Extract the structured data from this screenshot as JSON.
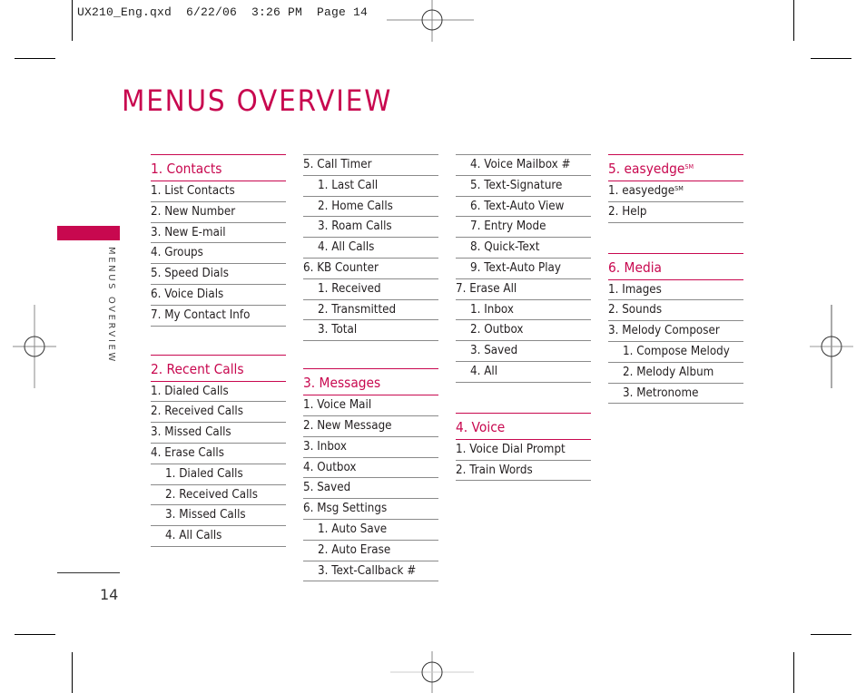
{
  "slug": {
    "text": "UX210_Eng.qxd  6/22/06  3:26 PM  Page 14"
  },
  "page": {
    "title": "MENUS OVERVIEW",
    "side_label": "MENUS OVERVIEW",
    "page_number": "14",
    "accent_color": "#c8084f"
  },
  "columns": [
    {
      "sections": [
        {
          "heading": "1. Contacts",
          "items": [
            {
              "label": "1. List Contacts",
              "level": 1
            },
            {
              "label": "2. New Number",
              "level": 1
            },
            {
              "label": "3. New E-mail",
              "level": 1
            },
            {
              "label": "4. Groups",
              "level": 1
            },
            {
              "label": "5. Speed Dials",
              "level": 1
            },
            {
              "label": "6. Voice Dials",
              "level": 1
            },
            {
              "label": "7.  My Contact Info",
              "level": 1
            }
          ]
        },
        {
          "heading": "2. Recent Calls",
          "items": [
            {
              "label": "1. Dialed Calls",
              "level": 1
            },
            {
              "label": "2. Received Calls",
              "level": 1
            },
            {
              "label": "3. Missed Calls",
              "level": 1
            },
            {
              "label": "4. Erase Calls",
              "level": 1
            },
            {
              "label": "1. Dialed Calls",
              "level": 2
            },
            {
              "label": "2. Received Calls",
              "level": 2
            },
            {
              "label": "3. Missed Calls",
              "level": 2
            },
            {
              "label": "4. All Calls",
              "level": 2
            }
          ]
        }
      ]
    },
    {
      "sections": [
        {
          "heading": null,
          "items": [
            {
              "label": "5. Call Timer",
              "level": 1
            },
            {
              "label": "1. Last Call",
              "level": 2
            },
            {
              "label": "2. Home Calls",
              "level": 2
            },
            {
              "label": "3. Roam Calls",
              "level": 2
            },
            {
              "label": "4. All Calls",
              "level": 2
            },
            {
              "label": "6. KB Counter",
              "level": 1
            },
            {
              "label": "1. Received",
              "level": 2
            },
            {
              "label": "2. Transmitted",
              "level": 2
            },
            {
              "label": "3. Total",
              "level": 2
            }
          ]
        },
        {
          "heading": "3. Messages",
          "items": [
            {
              "label": "1. Voice Mail",
              "level": 1
            },
            {
              "label": "2. New Message",
              "level": 1
            },
            {
              "label": "3. Inbox",
              "level": 1
            },
            {
              "label": "4. Outbox",
              "level": 1
            },
            {
              "label": "5. Saved",
              "level": 1
            },
            {
              "label": "6. Msg Settings",
              "level": 1
            },
            {
              "label": "1. Auto Save",
              "level": 2
            },
            {
              "label": "2. Auto Erase",
              "level": 2
            },
            {
              "label": "3. Text-Callback #",
              "level": 2
            }
          ]
        }
      ]
    },
    {
      "sections": [
        {
          "heading": null,
          "items": [
            {
              "label": "4. Voice Mailbox #",
              "level": 2
            },
            {
              "label": "5. Text-Signature",
              "level": 2
            },
            {
              "label": "6. Text-Auto View",
              "level": 2
            },
            {
              "label": "7. Entry Mode",
              "level": 2
            },
            {
              "label": "8. Quick-Text",
              "level": 2
            },
            {
              "label": "9. Text-Auto Play",
              "level": 2
            },
            {
              "label": "7. Erase All",
              "level": 1
            },
            {
              "label": "1. Inbox",
              "level": 2
            },
            {
              "label": "2. Outbox",
              "level": 2
            },
            {
              "label": "3. Saved",
              "level": 2
            },
            {
              "label": "4. All",
              "level": 2
            }
          ]
        },
        {
          "heading": "4. Voice",
          "items": [
            {
              "label": "1. Voice Dial Prompt",
              "level": 1
            },
            {
              "label": "2. Train Words",
              "level": 1
            }
          ]
        }
      ]
    },
    {
      "sections": [
        {
          "heading": "5. easyedge",
          "heading_sup": "SM",
          "items": [
            {
              "label": "1. easyedge",
              "sup": "SM",
              "level": 1
            },
            {
              "label": "2. Help",
              "level": 1
            }
          ]
        },
        {
          "heading": "6. Media",
          "items": [
            {
              "label": "1. Images",
              "level": 1
            },
            {
              "label": "2. Sounds",
              "level": 1
            },
            {
              "label": "3. Melody Composer",
              "level": 1
            },
            {
              "label": "1. Compose Melody",
              "level": 2
            },
            {
              "label": "2. Melody Album",
              "level": 2
            },
            {
              "label": "3. Metronome",
              "level": 2
            }
          ]
        }
      ]
    }
  ]
}
